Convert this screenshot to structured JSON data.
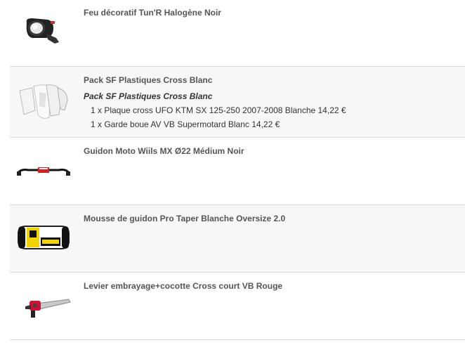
{
  "products": [
    {
      "title": "Feu décoratif Tun'R Halogène Noir",
      "image_icon": "headlight-icon"
    },
    {
      "title": "Pack SF Plastiques Cross Blanc",
      "image_icon": "plastics-kit-icon",
      "pack": {
        "name": "Pack SF Plastiques Cross Blanc",
        "items": [
          "1 x Plaque cross UFO KTM SX 125-250 2007-2008 Blanche 14,22 €",
          "1 x Garde boue AV VB Supermotard Blanc 14,22 €"
        ]
      }
    },
    {
      "title": "Guidon Moto Wiils MX Ø22 Médium Noir",
      "image_icon": "handlebar-icon"
    },
    {
      "title": "Mousse de guidon Pro Taper Blanche Oversize 2.0",
      "image_icon": "handlebar-pad-icon"
    },
    {
      "title": "Levier embrayage+cocotte Cross court VB Rouge",
      "image_icon": "clutch-lever-icon"
    }
  ]
}
